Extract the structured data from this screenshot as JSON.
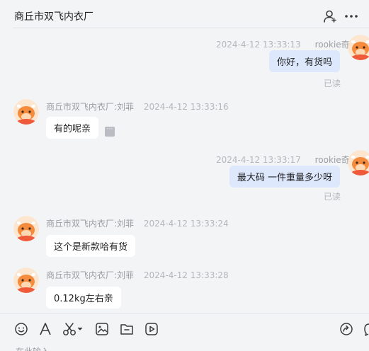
{
  "header": {
    "title": "商丘市双飞内衣厂",
    "icons": [
      "person-add-icon",
      "more-icon"
    ]
  },
  "messages": [
    {
      "direction": "out",
      "timestamp": "2024-4-12 13:33:13",
      "sender": "rookie奇",
      "text": "你好，有货吗",
      "status": "已读"
    },
    {
      "direction": "in",
      "sender": "商丘市双飞内衣厂:刘菲",
      "timestamp": "2024-4-12 13:33:16",
      "text": "有的呢亲"
    },
    {
      "direction": "out",
      "timestamp": "2024-4-12 13:33:17",
      "sender": "rookie奇",
      "text": "最大码 一件重量多少呀",
      "status": "已读"
    },
    {
      "direction": "in",
      "sender": "商丘市双飞内衣厂:刘菲",
      "timestamp": "2024-4-12 13:33:24",
      "text": "这个是新款哈有货"
    },
    {
      "direction": "in",
      "sender": "商丘市双飞内衣厂:刘菲",
      "timestamp": "2024-4-12 13:33:28",
      "text": "0.12kg左右亲"
    }
  ],
  "toolbar": {
    "icons": [
      "emoji-icon",
      "font-icon",
      "scissors-icon",
      "image-icon",
      "folder-icon",
      "video-icon",
      "quick-reply-icon",
      "chat-icon"
    ]
  },
  "input": {
    "placeholder": "在此输入..."
  },
  "colors": {
    "background": "#f3f4f6",
    "incoming_bubble": "#ffffff",
    "outgoing_bubble": "#dde8fd",
    "meta_text": "#b4b6ba",
    "avatar_orange": "#f58b3c"
  }
}
